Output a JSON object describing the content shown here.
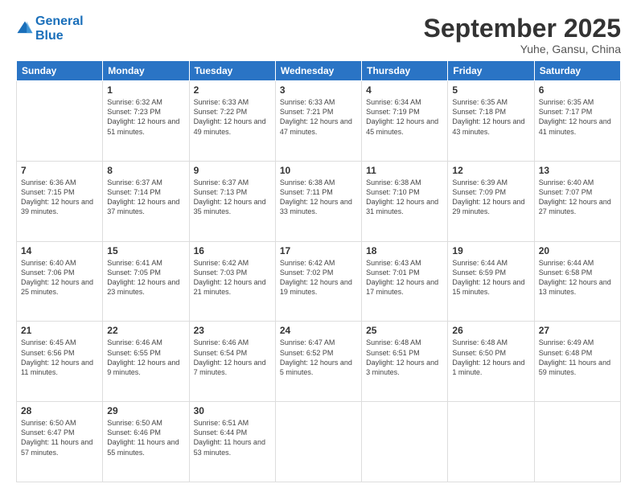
{
  "header": {
    "logo_general": "General",
    "logo_blue": "Blue",
    "title": "September 2025",
    "subtitle": "Yuhe, Gansu, China"
  },
  "days_of_week": [
    "Sunday",
    "Monday",
    "Tuesday",
    "Wednesday",
    "Thursday",
    "Friday",
    "Saturday"
  ],
  "weeks": [
    [
      {
        "day": "",
        "sunrise": "",
        "sunset": "",
        "daylight": ""
      },
      {
        "day": "1",
        "sunrise": "Sunrise: 6:32 AM",
        "sunset": "Sunset: 7:23 PM",
        "daylight": "Daylight: 12 hours and 51 minutes."
      },
      {
        "day": "2",
        "sunrise": "Sunrise: 6:33 AM",
        "sunset": "Sunset: 7:22 PM",
        "daylight": "Daylight: 12 hours and 49 minutes."
      },
      {
        "day": "3",
        "sunrise": "Sunrise: 6:33 AM",
        "sunset": "Sunset: 7:21 PM",
        "daylight": "Daylight: 12 hours and 47 minutes."
      },
      {
        "day": "4",
        "sunrise": "Sunrise: 6:34 AM",
        "sunset": "Sunset: 7:19 PM",
        "daylight": "Daylight: 12 hours and 45 minutes."
      },
      {
        "day": "5",
        "sunrise": "Sunrise: 6:35 AM",
        "sunset": "Sunset: 7:18 PM",
        "daylight": "Daylight: 12 hours and 43 minutes."
      },
      {
        "day": "6",
        "sunrise": "Sunrise: 6:35 AM",
        "sunset": "Sunset: 7:17 PM",
        "daylight": "Daylight: 12 hours and 41 minutes."
      }
    ],
    [
      {
        "day": "7",
        "sunrise": "Sunrise: 6:36 AM",
        "sunset": "Sunset: 7:15 PM",
        "daylight": "Daylight: 12 hours and 39 minutes."
      },
      {
        "day": "8",
        "sunrise": "Sunrise: 6:37 AM",
        "sunset": "Sunset: 7:14 PM",
        "daylight": "Daylight: 12 hours and 37 minutes."
      },
      {
        "day": "9",
        "sunrise": "Sunrise: 6:37 AM",
        "sunset": "Sunset: 7:13 PM",
        "daylight": "Daylight: 12 hours and 35 minutes."
      },
      {
        "day": "10",
        "sunrise": "Sunrise: 6:38 AM",
        "sunset": "Sunset: 7:11 PM",
        "daylight": "Daylight: 12 hours and 33 minutes."
      },
      {
        "day": "11",
        "sunrise": "Sunrise: 6:38 AM",
        "sunset": "Sunset: 7:10 PM",
        "daylight": "Daylight: 12 hours and 31 minutes."
      },
      {
        "day": "12",
        "sunrise": "Sunrise: 6:39 AM",
        "sunset": "Sunset: 7:09 PM",
        "daylight": "Daylight: 12 hours and 29 minutes."
      },
      {
        "day": "13",
        "sunrise": "Sunrise: 6:40 AM",
        "sunset": "Sunset: 7:07 PM",
        "daylight": "Daylight: 12 hours and 27 minutes."
      }
    ],
    [
      {
        "day": "14",
        "sunrise": "Sunrise: 6:40 AM",
        "sunset": "Sunset: 7:06 PM",
        "daylight": "Daylight: 12 hours and 25 minutes."
      },
      {
        "day": "15",
        "sunrise": "Sunrise: 6:41 AM",
        "sunset": "Sunset: 7:05 PM",
        "daylight": "Daylight: 12 hours and 23 minutes."
      },
      {
        "day": "16",
        "sunrise": "Sunrise: 6:42 AM",
        "sunset": "Sunset: 7:03 PM",
        "daylight": "Daylight: 12 hours and 21 minutes."
      },
      {
        "day": "17",
        "sunrise": "Sunrise: 6:42 AM",
        "sunset": "Sunset: 7:02 PM",
        "daylight": "Daylight: 12 hours and 19 minutes."
      },
      {
        "day": "18",
        "sunrise": "Sunrise: 6:43 AM",
        "sunset": "Sunset: 7:01 PM",
        "daylight": "Daylight: 12 hours and 17 minutes."
      },
      {
        "day": "19",
        "sunrise": "Sunrise: 6:44 AM",
        "sunset": "Sunset: 6:59 PM",
        "daylight": "Daylight: 12 hours and 15 minutes."
      },
      {
        "day": "20",
        "sunrise": "Sunrise: 6:44 AM",
        "sunset": "Sunset: 6:58 PM",
        "daylight": "Daylight: 12 hours and 13 minutes."
      }
    ],
    [
      {
        "day": "21",
        "sunrise": "Sunrise: 6:45 AM",
        "sunset": "Sunset: 6:56 PM",
        "daylight": "Daylight: 12 hours and 11 minutes."
      },
      {
        "day": "22",
        "sunrise": "Sunrise: 6:46 AM",
        "sunset": "Sunset: 6:55 PM",
        "daylight": "Daylight: 12 hours and 9 minutes."
      },
      {
        "day": "23",
        "sunrise": "Sunrise: 6:46 AM",
        "sunset": "Sunset: 6:54 PM",
        "daylight": "Daylight: 12 hours and 7 minutes."
      },
      {
        "day": "24",
        "sunrise": "Sunrise: 6:47 AM",
        "sunset": "Sunset: 6:52 PM",
        "daylight": "Daylight: 12 hours and 5 minutes."
      },
      {
        "day": "25",
        "sunrise": "Sunrise: 6:48 AM",
        "sunset": "Sunset: 6:51 PM",
        "daylight": "Daylight: 12 hours and 3 minutes."
      },
      {
        "day": "26",
        "sunrise": "Sunrise: 6:48 AM",
        "sunset": "Sunset: 6:50 PM",
        "daylight": "Daylight: 12 hours and 1 minute."
      },
      {
        "day": "27",
        "sunrise": "Sunrise: 6:49 AM",
        "sunset": "Sunset: 6:48 PM",
        "daylight": "Daylight: 11 hours and 59 minutes."
      }
    ],
    [
      {
        "day": "28",
        "sunrise": "Sunrise: 6:50 AM",
        "sunset": "Sunset: 6:47 PM",
        "daylight": "Daylight: 11 hours and 57 minutes."
      },
      {
        "day": "29",
        "sunrise": "Sunrise: 6:50 AM",
        "sunset": "Sunset: 6:46 PM",
        "daylight": "Daylight: 11 hours and 55 minutes."
      },
      {
        "day": "30",
        "sunrise": "Sunrise: 6:51 AM",
        "sunset": "Sunset: 6:44 PM",
        "daylight": "Daylight: 11 hours and 53 minutes."
      },
      {
        "day": "",
        "sunrise": "",
        "sunset": "",
        "daylight": ""
      },
      {
        "day": "",
        "sunrise": "",
        "sunset": "",
        "daylight": ""
      },
      {
        "day": "",
        "sunrise": "",
        "sunset": "",
        "daylight": ""
      },
      {
        "day": "",
        "sunrise": "",
        "sunset": "",
        "daylight": ""
      }
    ]
  ]
}
